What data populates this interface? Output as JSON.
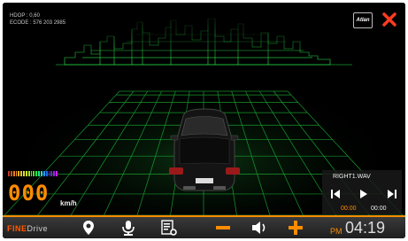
{
  "hud": {
    "hdop": "HDOP : 0,60",
    "ecode": "ECODE : 576 203 2985"
  },
  "atlan_button": {
    "label": "Atlan"
  },
  "speed": {
    "value": "000",
    "unit": "km/h"
  },
  "media": {
    "filename": "RIGHT1.WAV",
    "current_time": "00:00",
    "total_time": "00:00",
    "controls": [
      "previous-icon",
      "play-icon",
      "next-icon"
    ]
  },
  "toolbar": {
    "brand_part1": "FINE",
    "brand_part2": "Drive",
    "icons": [
      "location-pin-icon",
      "microphone-icon",
      "settings-list-icon",
      "zoom-out-icon",
      "volume-icon",
      "zoom-in-icon"
    ],
    "ampm": "PM",
    "time": "04:19"
  },
  "colors": {
    "accent": "#ff8c00",
    "close": "#ff3b1f",
    "grid": "#22dd44",
    "background": "#000000"
  }
}
